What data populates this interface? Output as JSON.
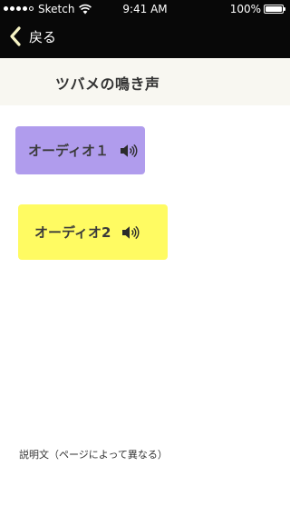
{
  "status_bar": {
    "carrier": "Sketch",
    "time": "9:41 AM",
    "battery_percent": "100%",
    "battery_level": 1.0,
    "signal_bars_filled": 4,
    "signal_bars_total": 5,
    "icons": [
      "signal-dots-icon",
      "wifi-icon",
      "battery-icon"
    ]
  },
  "nav": {
    "back_label": "戻る",
    "back_icon": "chevron-left-icon"
  },
  "header": {
    "title": "ツバメの鳴き声"
  },
  "audio_buttons": [
    {
      "label": "オーディオ１",
      "icon": "speaker-icon",
      "color": "#b09ced"
    },
    {
      "label": "オーディオ2",
      "icon": "speaker-icon",
      "color": "#fffb62"
    }
  ],
  "description": "説明文（ページによって異なる）",
  "colors": {
    "top_bar": "#080808",
    "title_band": "#f8f7f1",
    "back_chevron": "#f6f3c4"
  }
}
